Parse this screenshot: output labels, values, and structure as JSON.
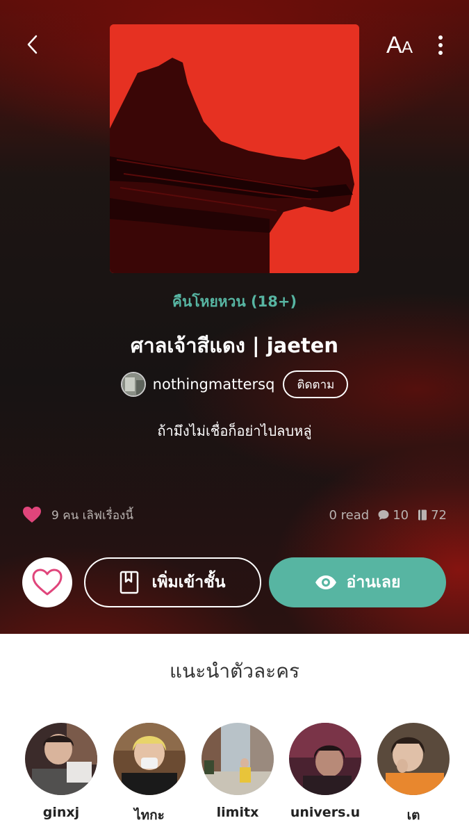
{
  "header": {
    "back_icon": "chevron-left-icon",
    "font_size_label_big": "A",
    "font_size_label_small": "A",
    "more_icon": "more-vertical-icon"
  },
  "story": {
    "category": "คืนโหยหวน (18+)",
    "title": "ศาลเจ้าสีแดง | jaeten",
    "author": "nothingmattersq",
    "follow_label": "ติดตาม",
    "tagline": "ถ้ามึงไม่เชื่อก็อย่าไปลบหลู่",
    "love_text": "9 คน เลิฟเรื่องนี้",
    "reads": "0 read",
    "comments": "10",
    "chapters": "72"
  },
  "actions": {
    "add_library_label": "เพิ่มเข้าชั้น",
    "read_label": "อ่านเลย"
  },
  "characters_section": {
    "title": "แนะนำตัวละคร",
    "items": [
      {
        "name": "ginxj"
      },
      {
        "name": "ไทกะ"
      },
      {
        "name": "limitx"
      },
      {
        "name": "univers.u"
      },
      {
        "name": "เต"
      }
    ]
  },
  "colors": {
    "accent": "#57b5a2",
    "heart": "#e0457b",
    "cover_red": "#e63122"
  }
}
